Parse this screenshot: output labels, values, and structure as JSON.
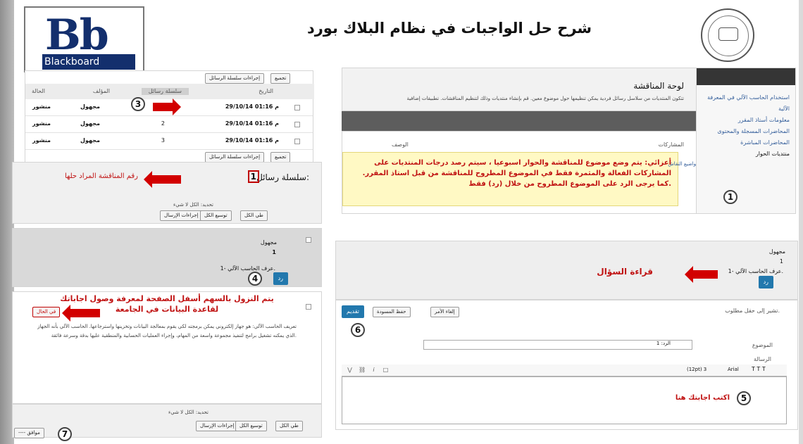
{
  "title": "شرح حل الواجبات في نظام البلاك بورد",
  "logo": {
    "bb": "Bb",
    "word": "Blackboard"
  },
  "discussion": {
    "panel_title": "لوحة المناقشة",
    "description": "تتكون المنتديات من سلاسل رسائل فردية يمكن تنظيمها حول موضوع معين. قم بإنشاء منتديات وذلك لتنظيم المناقشات. تطبيقات إضافية",
    "sidebar": {
      "items": [
        "استخدام الحاسب الآلي في المعرفة الآلية",
        "معلومات أستاذ المقرر",
        "المحاضرات المسجلة والمحتوى",
        "المحاضرات المباشرة",
        "منتديات الحوار"
      ],
      "marker": "1"
    },
    "message_columns": {
      "author": "المشاركات",
      "title": "الوصف"
    },
    "note": "أعزائي: يتم وضع موضوع للمناقشة والحوار اسبوعيا ، سيتم رصد درجات المنتديات على المشاركات الفعالة والمثمرة فقط في الموضوع المطروح للمناقشة من قبل استاذ المقرر. كما يرجى الرد على الموضوع المطروح من خلال (رد) فقط.",
    "topic_link": "مواضيع النقاش",
    "marker2": "2"
  },
  "question": {
    "anonymous": "مجهول",
    "number": "1",
    "question_line": "1- عرف الحاسب الآلي.",
    "read_label": "قراءة السؤال",
    "reply_button": "رد"
  },
  "reply_form": {
    "required_note": "تشير إلى حقل مطلوب.",
    "cancel": "إلغاء الأمر",
    "save_draft": "حفظ المسودة",
    "submit": "تقديم",
    "subject_label": "الموضوع",
    "subject_value": "الرد: 1",
    "message_label": "الرسالة",
    "toolbar": {
      "font": "Arial",
      "size": "(12pt) 3"
    },
    "write_hint": "اكتب اجابتك هنا",
    "marker5": "5",
    "marker6": "6"
  },
  "thread_list": {
    "actions": "إجراءات سلسلة الرسائل",
    "collect": "تجميع",
    "columns": {
      "date": "التاريخ",
      "thread": "سلسلة رسائل",
      "author": "المؤلف",
      "status": "الحالة"
    },
    "rows": [
      {
        "date": "29/10/14 01:16 م",
        "thread": "1",
        "author": "مجهول",
        "status": "منشور"
      },
      {
        "date": "29/10/14 01:16 م",
        "thread": "2",
        "author": "مجهول",
        "status": "منشور"
      },
      {
        "date": "29/10/14 01:16 م",
        "thread": "3",
        "author": "مجهول",
        "status": "منشور"
      }
    ],
    "marker3": "3"
  },
  "thread_detail": {
    "label": "سلسلة رسائل:",
    "number": "1",
    "annotation": "رقم المناقشة المراد حلها",
    "select": "تحديد: الكل لا شيء",
    "actions": [
      "إجراءات الإرسال",
      "توسيع الكل",
      "طي الكل"
    ],
    "anonymous": "مجهول",
    "reply_number": "1",
    "question_line": "1- عرف الحاسب الآلي.",
    "reply_button": "رد",
    "marker4": "4"
  },
  "answer_area": {
    "scroll_note": "يتم النزول بالسهم أسفل الصفحة لمعرفة وصول اجاباتك لقاعدة البيانات في الجامعة",
    "status_button": "في الحال",
    "answer_text": "تعريف الحاسب الآلي: هو جهاز إلكتروني يمكن برمجته لكي يقوم بمعالجة البيانات وتخزينها واسترجاعها. الحاسب الآلي بأنه الجهاز الذي يمكنه تشغيل برامج لتنفيذ مجموعة واسعة من المهام، وإجراء العمليات الحسابية والمنطقية عليها بدقة وسرعة فائقة.",
    "bottom_select": "تحديد: الكل لا شيء",
    "bottom_actions": [
      "إجراءات الإرسال",
      "توسيع الكل",
      "طي الكل"
    ],
    "ok": "---- موافق",
    "marker7": "7"
  }
}
